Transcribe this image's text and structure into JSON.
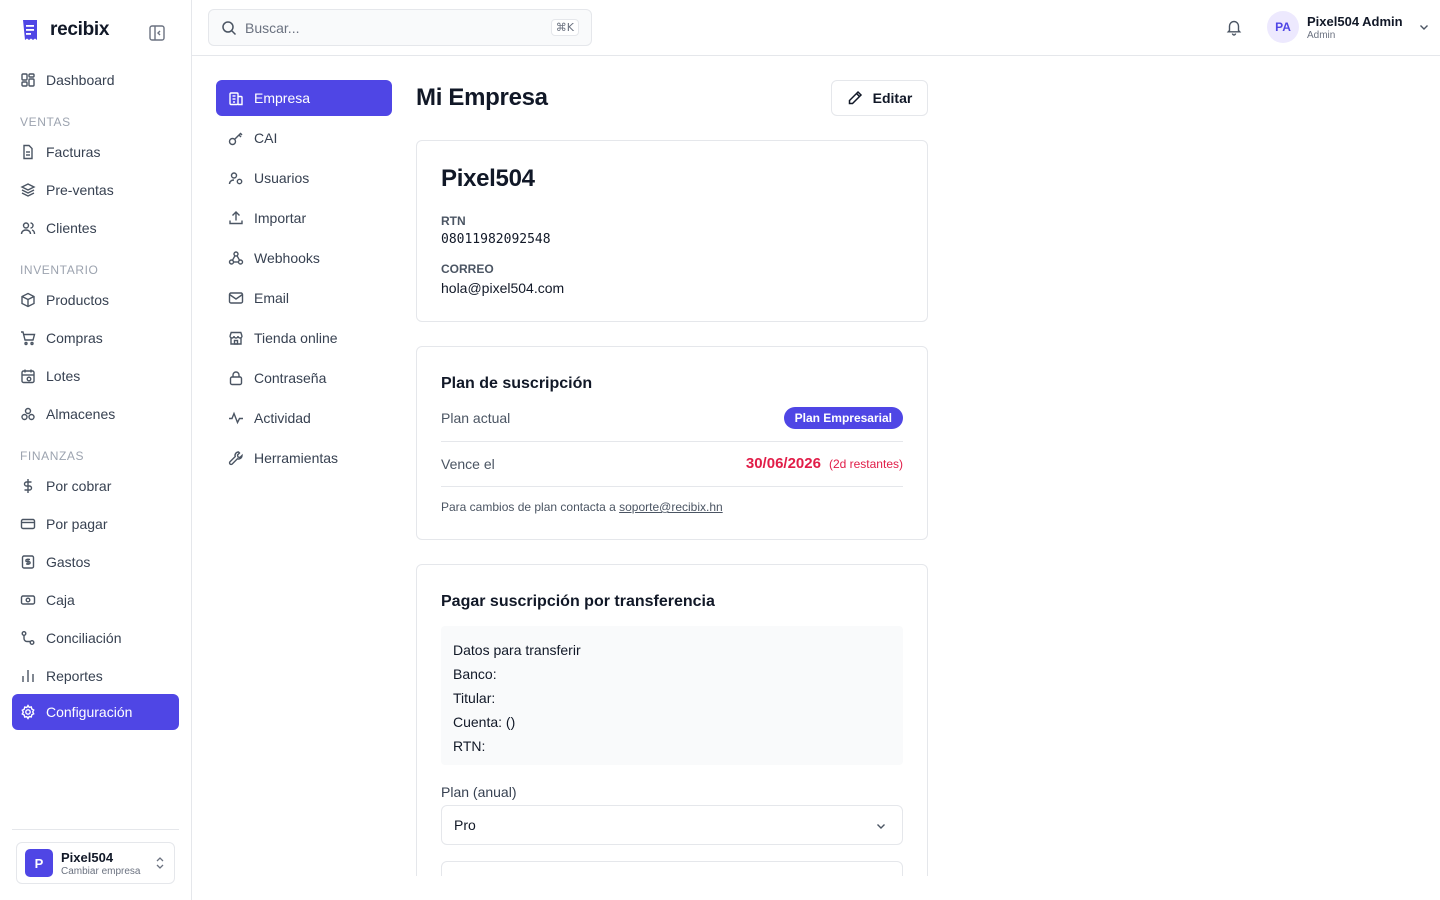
{
  "app": {
    "brand": "recibix"
  },
  "sidebar": {
    "dashboard": "Dashboard",
    "sections": {
      "ventas": "VENTAS",
      "inventario": "INVENTARIO",
      "finanzas": "FINANZAS"
    },
    "items": [
      {
        "label": "Facturas",
        "icon": "document-icon"
      },
      {
        "label": "Pre-ventas",
        "icon": "layers-icon"
      },
      {
        "label": "Clientes",
        "icon": "users-icon"
      },
      {
        "label": "Productos",
        "icon": "box-icon"
      },
      {
        "label": "Compras",
        "icon": "cart-icon"
      },
      {
        "label": "Lotes",
        "icon": "calendar-icon"
      },
      {
        "label": "Almacenes",
        "icon": "warehouse-icon"
      },
      {
        "label": "Por cobrar",
        "icon": "dollar-icon"
      },
      {
        "label": "Por pagar",
        "icon": "credit-card-icon"
      },
      {
        "label": "Gastos",
        "icon": "receipt-icon"
      },
      {
        "label": "Caja",
        "icon": "cash-icon"
      },
      {
        "label": "Conciliación",
        "icon": "route-icon"
      },
      {
        "label": "Reportes",
        "icon": "bar-chart-icon"
      },
      {
        "label": "Configuración",
        "icon": "gear-icon"
      }
    ],
    "company_switcher": {
      "initial": "P",
      "name": "Pixel504",
      "subtitle": "Cambiar empresa"
    }
  },
  "topbar": {
    "search_placeholder": "Buscar...",
    "search_shortcut": "⌘K",
    "user": {
      "initials": "PA",
      "name": "Pixel504 Admin",
      "role": "Admin"
    }
  },
  "settings_nav": [
    {
      "label": "Empresa",
      "icon": "building-icon"
    },
    {
      "label": "CAI",
      "icon": "key-icon"
    },
    {
      "label": "Usuarios",
      "icon": "users-icon"
    },
    {
      "label": "Importar",
      "icon": "upload-icon"
    },
    {
      "label": "Webhooks",
      "icon": "webhook-icon"
    },
    {
      "label": "Email",
      "icon": "mail-icon"
    },
    {
      "label": "Tienda online",
      "icon": "store-icon"
    },
    {
      "label": "Contraseña",
      "icon": "lock-icon"
    },
    {
      "label": "Actividad",
      "icon": "activity-icon"
    },
    {
      "label": "Herramientas",
      "icon": "wrench-icon"
    }
  ],
  "main": {
    "title": "Mi Empresa",
    "edit_label": "Editar",
    "company": {
      "name": "Pixel504",
      "rtn_label": "RTN",
      "rtn": "08011982092548",
      "email_label": "CORREO",
      "email": "hola@pixel504.com"
    },
    "plan": {
      "title": "Plan de suscripción",
      "current_label": "Plan actual",
      "current_value": "Plan Empresarial",
      "expires_label": "Vence el",
      "expires_date": "30/06/2026",
      "expires_remaining": "(2d restantes)",
      "note_prefix": "Para cambios de plan contacta a ",
      "note_email": "soporte@recibix.hn"
    },
    "transfer": {
      "title": "Pagar suscripción por transferencia",
      "box_title": "Datos para transferir",
      "bank_label": "Banco:",
      "holder_label": "Titular:",
      "account_label": "Cuenta: ()",
      "rtn_label": "RTN:",
      "plan_label": "Plan (anual)",
      "plan_value": "Pro"
    }
  },
  "colors": {
    "accent": "#4f46e5",
    "danger": "#e11d48",
    "border": "#e5e7eb"
  }
}
